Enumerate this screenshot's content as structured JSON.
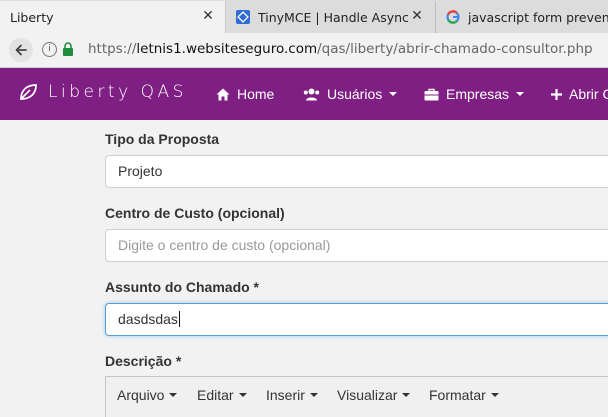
{
  "browser": {
    "tabs": [
      {
        "title": "Liberty",
        "close": "✕"
      },
      {
        "title": "TinyMCE | Handle Async Im",
        "close": "✕"
      },
      {
        "title": "javascript form prevent defa"
      }
    ],
    "url": {
      "scheme": "https://",
      "domain": "letnis1.websiteseguro.com",
      "path": "/qas/liberty/abrir-chamado-consultor.php"
    }
  },
  "navbar": {
    "brand": "Liberty QAS",
    "items": [
      {
        "label": "Home",
        "icon": "home-icon"
      },
      {
        "label": "Usuários",
        "icon": "users-icon"
      },
      {
        "label": "Empresas",
        "icon": "briefcase-icon"
      },
      {
        "label": "Abrir C",
        "icon": "plus-icon"
      }
    ]
  },
  "form": {
    "tipo_label": "Tipo da Proposta",
    "tipo_value": "Projeto",
    "centro_label": "Centro de Custo (opcional)",
    "centro_placeholder": "Digite o centro de custo (opcional)",
    "assunto_label": "Assunto do Chamado *",
    "assunto_value": "dasdsdas",
    "descricao_label": "Descrição *",
    "editor_menus": [
      "Arquivo",
      "Editar",
      "Inserir",
      "Visualizar",
      "Formatar"
    ]
  },
  "colors": {
    "navbar": "#7f1f83",
    "focus_border": "#5aa0d8",
    "secure_lock": "#1e8e3e"
  }
}
